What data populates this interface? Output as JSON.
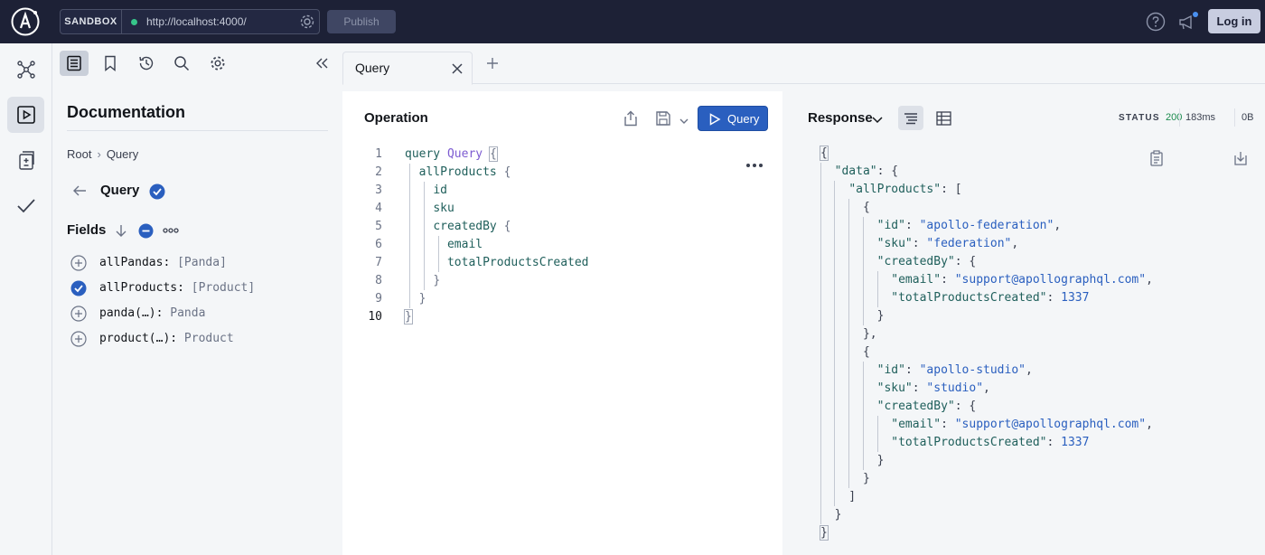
{
  "topbar": {
    "sandbox_label": "SANDBOX",
    "endpoint_url": "http://localhost:4000/",
    "publish_label": "Publish",
    "login_label": "Log in",
    "connection_status_color": "#36c58a"
  },
  "leftnav": {
    "items": [
      {
        "icon": "schema-graph-icon",
        "active": false
      },
      {
        "icon": "explorer-play-icon",
        "active": true
      },
      {
        "icon": "changelog-diff-icon",
        "active": false
      },
      {
        "icon": "checks-icon",
        "active": false
      }
    ]
  },
  "docs": {
    "title": "Documentation",
    "breadcrumb": [
      "Root",
      "Query"
    ],
    "type_name": "Query",
    "fields_title": "Fields",
    "fields": [
      {
        "name": "allPandas:",
        "type": "[Panda]",
        "selected": false
      },
      {
        "name": "allProducts:",
        "type": "[Product]",
        "selected": true
      },
      {
        "name": "panda(…):",
        "type": "Panda",
        "selected": false
      },
      {
        "name": "product(…):",
        "type": "Product",
        "selected": false
      }
    ]
  },
  "tabs": [
    {
      "label": "Query",
      "active": true
    }
  ],
  "operation": {
    "title": "Operation",
    "run_label": "Query",
    "line_numbers": [
      "1",
      "2",
      "3",
      "4",
      "5",
      "6",
      "7",
      "8",
      "9",
      "10"
    ],
    "lines": {
      "l1_kw": "query",
      "l1_name": "Query",
      "l1_brace": "{",
      "l2": "allProducts",
      "l2_brace": "{",
      "l3": "id",
      "l4": "sku",
      "l5": "createdBy",
      "l5_brace": "{",
      "l6": "email",
      "l7": "totalProductsCreated",
      "l8": "}",
      "l9": "}",
      "l10": "}"
    }
  },
  "response": {
    "title": "Response",
    "status_label": "STATUS",
    "status_code": "200",
    "time": "183ms",
    "size": "0B",
    "json": {
      "open": "{",
      "data_key": "\"data\"",
      "all_products_key": "\"allProducts\"",
      "id_key": "\"id\"",
      "sku_key": "\"sku\"",
      "created_by_key": "\"createdBy\"",
      "email_key": "\"email\"",
      "total_key": "\"totalProductsCreated\"",
      "item1_id": "\"apollo-federation\"",
      "item1_sku": "\"federation\"",
      "item1_email": "\"support@apollographql.com\"",
      "item1_total": "1337",
      "item2_id": "\"apollo-studio\"",
      "item2_sku": "\"studio\"",
      "item2_email": "\"support@apollographql.com\"",
      "item2_total": "1337",
      "close": "}"
    }
  }
}
